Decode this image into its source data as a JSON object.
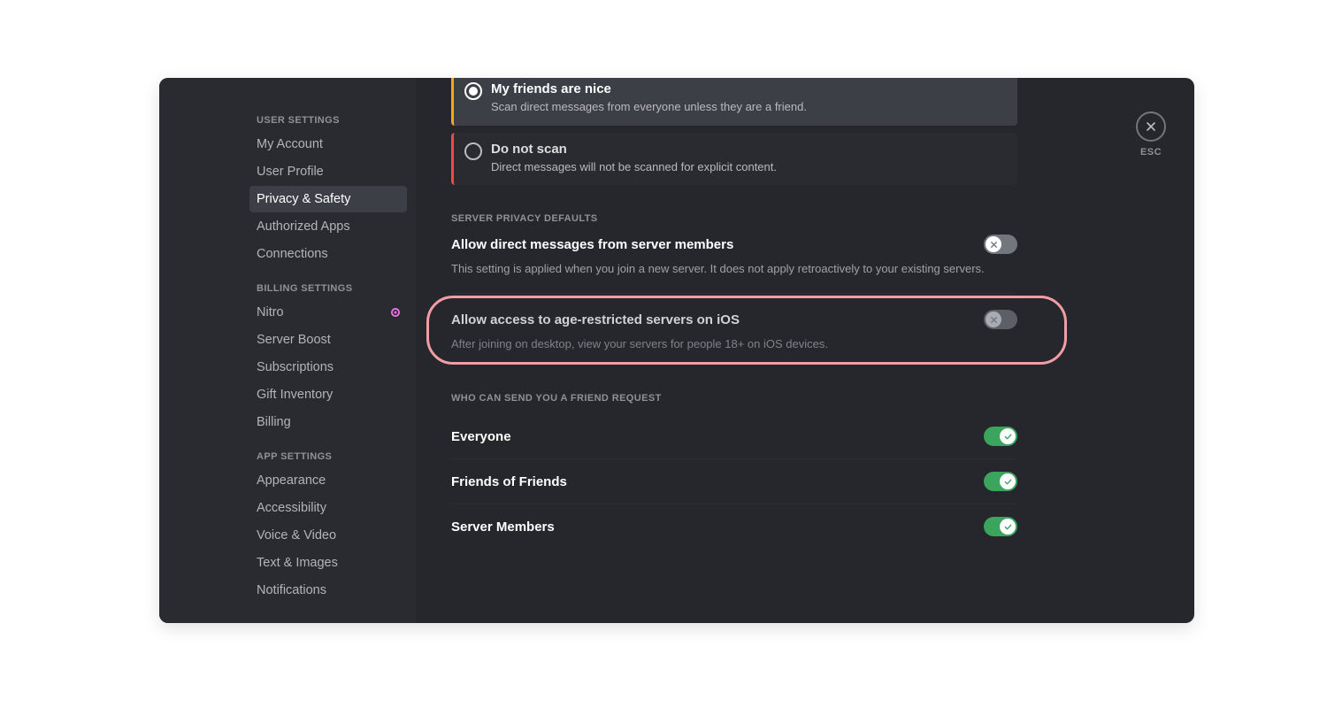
{
  "esc_label": "ESC",
  "sidebar": {
    "groups": [
      {
        "heading": "USER SETTINGS",
        "items": [
          {
            "label": "My Account"
          },
          {
            "label": "User Profile"
          },
          {
            "label": "Privacy & Safety",
            "active": true
          },
          {
            "label": "Authorized Apps"
          },
          {
            "label": "Connections"
          }
        ]
      },
      {
        "heading": "BILLING SETTINGS",
        "items": [
          {
            "label": "Nitro",
            "badge": true
          },
          {
            "label": "Server Boost"
          },
          {
            "label": "Subscriptions"
          },
          {
            "label": "Gift Inventory"
          },
          {
            "label": "Billing"
          }
        ]
      },
      {
        "heading": "APP SETTINGS",
        "items": [
          {
            "label": "Appearance"
          },
          {
            "label": "Accessibility"
          },
          {
            "label": "Voice & Video"
          },
          {
            "label": "Text & Images"
          },
          {
            "label": "Notifications"
          }
        ]
      }
    ]
  },
  "scan_options": [
    {
      "title": "My friends are nice",
      "desc": "Scan direct messages from everyone unless they are a friend.",
      "selected": true,
      "accent": "#faa61a"
    },
    {
      "title": "Do not scan",
      "desc": "Direct messages will not be scanned for explicit content.",
      "selected": false,
      "accent": "#f04747"
    }
  ],
  "server_privacy": {
    "heading": "SERVER PRIVACY DEFAULTS",
    "dm_label": "Allow direct messages from server members",
    "dm_desc": "This setting is applied when you join a new server. It does not apply retroactively to your existing servers.",
    "dm_on": false,
    "ios_label": "Allow access to age-restricted servers on iOS",
    "ios_desc": "After joining on desktop, view your servers for people 18+ on iOS devices.",
    "ios_on": false
  },
  "friend_requests": {
    "heading": "WHO CAN SEND YOU A FRIEND REQUEST",
    "options": [
      {
        "label": "Everyone",
        "on": true
      },
      {
        "label": "Friends of Friends",
        "on": true
      },
      {
        "label": "Server Members",
        "on": true
      }
    ]
  }
}
